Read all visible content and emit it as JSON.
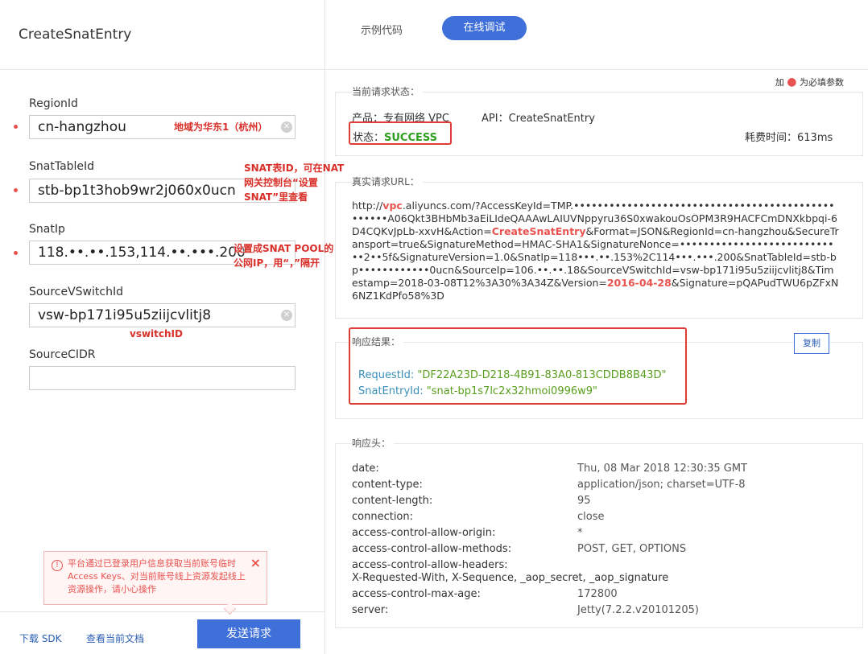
{
  "left": {
    "title": "CreateSnatEntry",
    "required_prefix": "加",
    "required_dot": "●",
    "required_suffix": " 为必填参数",
    "params": [
      {
        "label": "RegionId",
        "value": "cn-hangzhou",
        "required": true
      },
      {
        "label": "SnatTableId",
        "value": "stb-bp1t3hob9wr2j060x0ucn",
        "required": true
      },
      {
        "label": "SnatIp",
        "value": "118.••.••.153,114.••.•••.200",
        "required": true
      },
      {
        "label": "SourceVSwitchId",
        "value": "vsw-bp171i95u5ziijcvlitj8",
        "required": false
      },
      {
        "label": "SourceCIDR",
        "value": "",
        "required": false
      }
    ],
    "annotations": {
      "region": "地域为华东1（杭州）",
      "snat_table_1": "SNAT表ID，可在NAT",
      "snat_table_2": "网关控制台“设置",
      "snat_table_3": "SNAT”里查看",
      "snat_ip_1": "设置成SNAT POOL的",
      "snat_ip_2": "公网IP，用“，”隔开",
      "vswitch": "vswitchID"
    },
    "warning": {
      "text": "平台通过已登录用户信息获取当前账号临时Access Keys、对当前账号线上资源发起线上资源操作，请小心操作",
      "icon": "!",
      "close": "×"
    },
    "footer": {
      "download_sdk": "下载 SDK",
      "view_docs": "查看当前文档",
      "send": "发送请求"
    }
  },
  "right": {
    "tabs": {
      "sample_code": "示例代码",
      "online_debug": "在线调试"
    },
    "status_section": {
      "title": "当前请求状态：",
      "product_label": "产品：",
      "product": "专有网络 VPC",
      "api_label": "API：",
      "api": "CreateSnatEntry",
      "status_label": "状态：",
      "status": "SUCCESS",
      "time_label": "耗费时间：",
      "time": "613ms"
    },
    "url_section": {
      "title": "真实请求URL：",
      "p1": "http://",
      "p1_hl": "vpc",
      "p2": ".aliyuncs.com/?AccessKeyId=TMP.••••••••••••••••••••••••••••••••••••••••••••••••••A06Qkt3BHbMb3aEiLIdeQAAAwLAIUVNppyru36S0xwakouOsOPM3R9HACFCmDNXkbpqi-6D4CQKvJpLb-xxvH&Action=",
      "p2_hl": "CreateSnatEntry",
      "p3": "&Format=JSON&RegionId=cn-hangzhou&SecureTransport=true&SignatureMethod=HMAC-SHA1&SignatureNonce=••••••••••••••••••••••••••••2••5f&SignatureVersion=1.0&SnatIp=118•••.••.153%2C114•••.•••.200&SnatTableId=stb-bp••••••••••••0ucn&SourceIp=106.••.••.18&SourceVSwitchId=vsw-bp171i95u5ziijcvlitj8&Timestamp=2018-03-08T12%3A30%3A34Z&Version=",
      "p3_hl": "2016-04-28",
      "p4": "&Signature=pQAPudTWU6pZFxN6NZ1KdPfo58%3D"
    },
    "response_section": {
      "title": "响应结果：",
      "copy": "复制",
      "request_id_key": "RequestId:",
      "request_id": "\"DF22A23D-D218-4B91-83A0-813CDDB8B43D\"",
      "snat_entry_key": "SnatEntryId:",
      "snat_entry": "\"snat-bp1s7lc2x32hmoi0996w9\""
    },
    "headers_section": {
      "title": "响应头：",
      "rows": [
        {
          "key": "date:",
          "value": "Thu, 08 Mar 2018 12:30:35 GMT"
        },
        {
          "key": "content-type:",
          "value": "application/json; charset=UTF-8"
        },
        {
          "key": "content-length:",
          "value": "95"
        },
        {
          "key": "connection:",
          "value": "close"
        },
        {
          "key": "access-control-allow-origin:",
          "value": "*"
        },
        {
          "key": "access-control-allow-methods:",
          "value": "POST, GET, OPTIONS"
        },
        {
          "key": "access-control-allow-headers:",
          "value": "X-Requested-With, X-Sequence, _aop_secret, _aop_signature"
        },
        {
          "key": "access-control-max-age:",
          "value": "172800"
        },
        {
          "key": "server:",
          "value": "Jetty(7.2.2.v20101205)"
        }
      ]
    }
  },
  "colors": {
    "accent": "#3f6fd8",
    "success": "#2e9e1f",
    "required": "#e8534f",
    "annotation": "#d9302a"
  }
}
